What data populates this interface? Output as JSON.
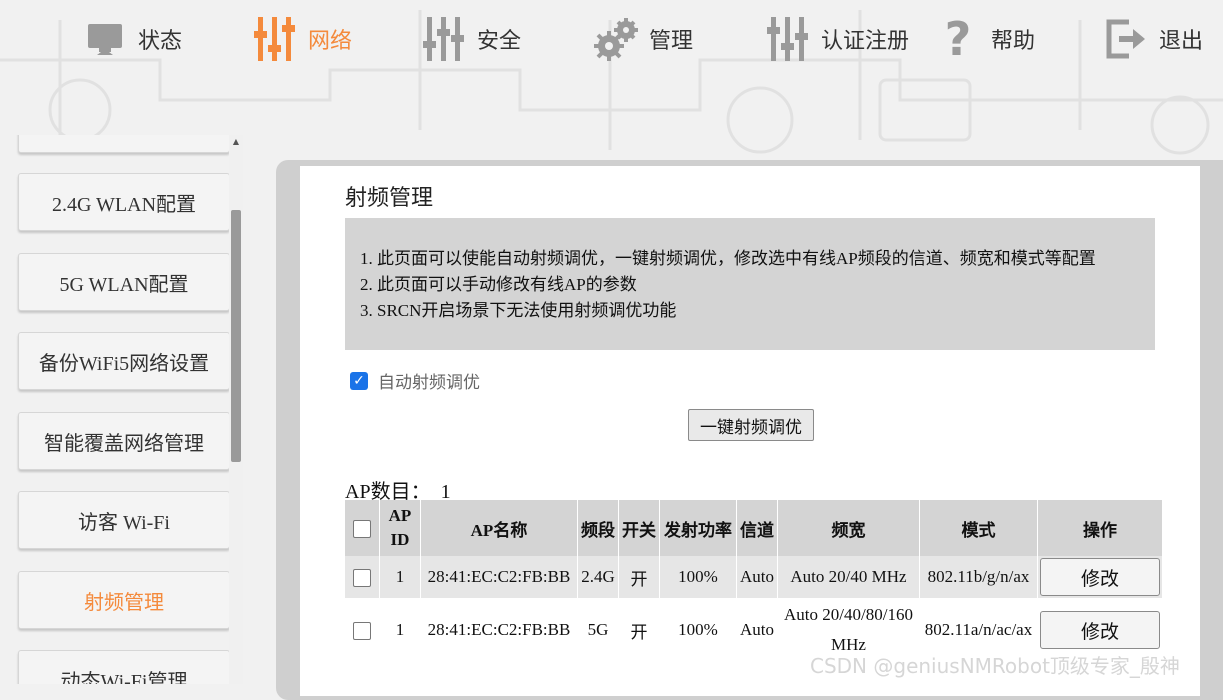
{
  "colors": {
    "accent": "#f48a3c",
    "icon_gray": "#9a9a9a",
    "panel_gray": "#d4d4d4",
    "checkbox_blue": "#1a73e8"
  },
  "nav": {
    "items": [
      {
        "label": "状态",
        "icon": "monitor-icon"
      },
      {
        "label": "网络",
        "icon": "sliders-icon",
        "active": true
      },
      {
        "label": "安全",
        "icon": "sliders-icon"
      },
      {
        "label": "管理",
        "icon": "gears-icon"
      },
      {
        "label": "认证注册",
        "icon": "sliders-icon"
      },
      {
        "label": "帮助",
        "icon": "question-icon"
      },
      {
        "label": "退出",
        "icon": "exit-icon"
      }
    ]
  },
  "sidebar": {
    "items": [
      {
        "label": "2.4G WLAN配置"
      },
      {
        "label": "5G WLAN配置"
      },
      {
        "label": "备份WiFi5网络设置"
      },
      {
        "label": "智能覆盖网络管理"
      },
      {
        "label": "访客 Wi-Fi"
      },
      {
        "label": "射频管理",
        "active": true
      },
      {
        "label": "动态Wi-Fi管理"
      }
    ]
  },
  "main": {
    "title": "射频管理",
    "notes": [
      "1. 此页面可以使能自动射频调优，一键射频调优，修改选中有线AP频段的信道、频宽和模式等配置",
      "2. 此页面可以手动修改有线AP的参数",
      "3. SRCN开启场景下无法使用射频调优功能"
    ],
    "auto_optimize_label": "自动射频调优",
    "auto_optimize_checked": true,
    "one_click_button": "一键射频调优",
    "ap_count_label": "AP数目：",
    "ap_count_value": "1"
  },
  "table": {
    "headers": [
      "AP ID",
      "AP名称",
      "频段",
      "开关",
      "发射功率",
      "信道",
      "频宽",
      "模式",
      "操作"
    ],
    "rows": [
      {
        "id": "1",
        "name": "28:41:EC:C2:FB:BB",
        "band": "2.4G",
        "switch": "开",
        "power": "100%",
        "channel": "Auto",
        "width": "Auto 20/40 MHz",
        "mode": "802.11b/g/n/ax",
        "action": "修改"
      },
      {
        "id": "1",
        "name": "28:41:EC:C2:FB:BB",
        "band": "5G",
        "switch": "开",
        "power": "100%",
        "channel": "Auto",
        "width": "Auto 20/40/80/160 MHz",
        "mode": "802.11a/n/ac/ax",
        "action": "修改"
      }
    ]
  },
  "watermark": "CSDN @geniusNMRobot顶级专家_殷神"
}
